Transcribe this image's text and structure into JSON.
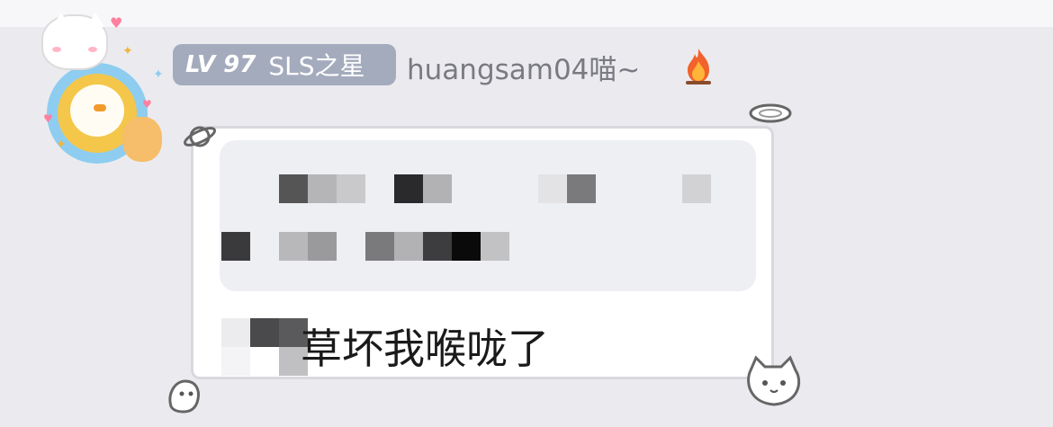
{
  "user": {
    "level_badge": "LV 97",
    "title_tag": "SLS之星",
    "username": "huangsam04喵~"
  },
  "message": {
    "reply_text": "草坏我喉咙了"
  },
  "colors": {
    "badge_bg": "#a4abbd",
    "page_bg": "#ebebef",
    "username_text": "#7a7a82"
  },
  "icons": {
    "streak": "fire-icon",
    "avatar": "cat-duck-avatar"
  }
}
